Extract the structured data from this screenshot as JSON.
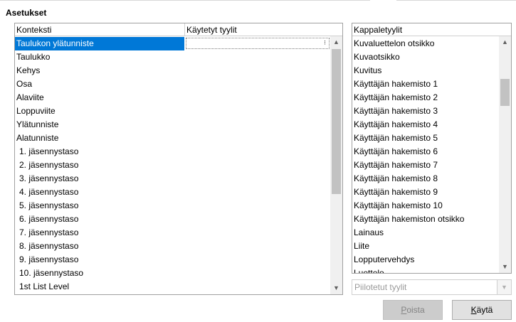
{
  "section_title": "Asetukset",
  "context_table": {
    "headers": [
      "Konteksti",
      "Käytetyt tyylit"
    ],
    "rows": [
      {
        "context": "Taulukon ylätunniste",
        "applied": "",
        "selected": true,
        "indent": false
      },
      {
        "context": "Taulukko",
        "applied": "",
        "selected": false,
        "indent": false
      },
      {
        "context": "Kehys",
        "applied": "",
        "selected": false,
        "indent": false
      },
      {
        "context": "Osa",
        "applied": "",
        "selected": false,
        "indent": false
      },
      {
        "context": "Alaviite",
        "applied": "",
        "selected": false,
        "indent": false
      },
      {
        "context": "Loppuviite",
        "applied": "",
        "selected": false,
        "indent": false
      },
      {
        "context": "Ylätunniste",
        "applied": "",
        "selected": false,
        "indent": false
      },
      {
        "context": "Alatunniste",
        "applied": "",
        "selected": false,
        "indent": false
      },
      {
        "context": "1. jäsennystaso",
        "applied": "",
        "selected": false,
        "indent": true
      },
      {
        "context": "2. jäsennystaso",
        "applied": "",
        "selected": false,
        "indent": true
      },
      {
        "context": "3. jäsennystaso",
        "applied": "",
        "selected": false,
        "indent": true
      },
      {
        "context": "4. jäsennystaso",
        "applied": "",
        "selected": false,
        "indent": true
      },
      {
        "context": "5. jäsennystaso",
        "applied": "",
        "selected": false,
        "indent": true
      },
      {
        "context": "6. jäsennystaso",
        "applied": "",
        "selected": false,
        "indent": true
      },
      {
        "context": "7. jäsennystaso",
        "applied": "",
        "selected": false,
        "indent": true
      },
      {
        "context": "8. jäsennystaso",
        "applied": "",
        "selected": false,
        "indent": true
      },
      {
        "context": "9. jäsennystaso",
        "applied": "",
        "selected": false,
        "indent": true
      },
      {
        "context": "10. jäsennystaso",
        "applied": "",
        "selected": false,
        "indent": true
      },
      {
        "context": "1st List Level",
        "applied": "",
        "selected": false,
        "indent": true
      }
    ]
  },
  "paragraph_styles": {
    "header": "Kappaletyylit",
    "items": [
      "Kuvaluettelon otsikko",
      "Kuvaotsikko",
      "Kuvitus",
      "Käyttäjän hakemisto 1",
      "Käyttäjän hakemisto 2",
      "Käyttäjän hakemisto 3",
      "Käyttäjän hakemisto 4",
      "Käyttäjän hakemisto 5",
      "Käyttäjän hakemisto 6",
      "Käyttäjän hakemisto 7",
      "Käyttäjän hakemisto 8",
      "Käyttäjän hakemisto 9",
      "Käyttäjän hakemisto 10",
      "Käyttäjän hakemiston otsikko",
      "Lainaus",
      "Liite",
      "Lopputervehdys",
      "Luettelo"
    ]
  },
  "filter_combo": {
    "value": "Piilotetut tyylit",
    "enabled": false
  },
  "buttons": {
    "delete": {
      "mnemonic": "P",
      "rest": "oista",
      "enabled": false
    },
    "apply": {
      "mnemonic": "K",
      "rest": "äytä",
      "enabled": true
    }
  },
  "icons": {
    "scroll_up": "chevron-up-icon",
    "scroll_down": "chevron-down-icon",
    "dropdown": "chevron-down-icon",
    "ellipsis": "ellipsis-icon"
  },
  "colors": {
    "selection": "#0078d7",
    "scroll_thumb": "#c2c2c2"
  }
}
